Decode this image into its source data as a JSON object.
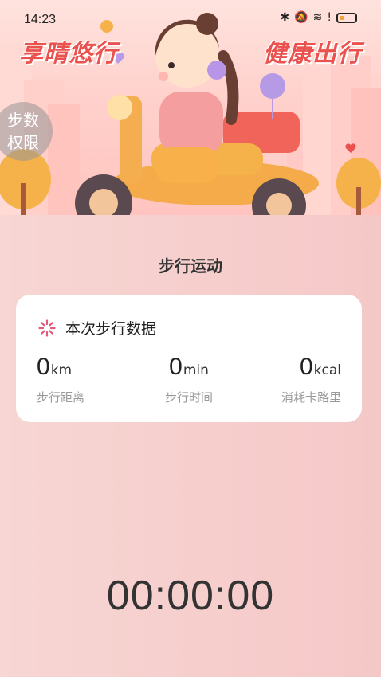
{
  "status_bar": {
    "time": "14:23"
  },
  "banner": {
    "slogan_left": "享晴悠行",
    "slogan_right": "健康出行",
    "step_permission_label": "步数权限"
  },
  "page_title": "步行运动",
  "card": {
    "title": "本次步行数据",
    "metrics": [
      {
        "value": "0",
        "unit": "km",
        "label": "步行距离"
      },
      {
        "value": "0",
        "unit": "min",
        "label": "步行时间"
      },
      {
        "value": "0",
        "unit": "kcal",
        "label": "消耗卡路里"
      }
    ]
  },
  "timer": "00:00:00",
  "colors": {
    "accent": "#e9524e",
    "background": "#f6cfcd",
    "card": "#ffffff"
  }
}
